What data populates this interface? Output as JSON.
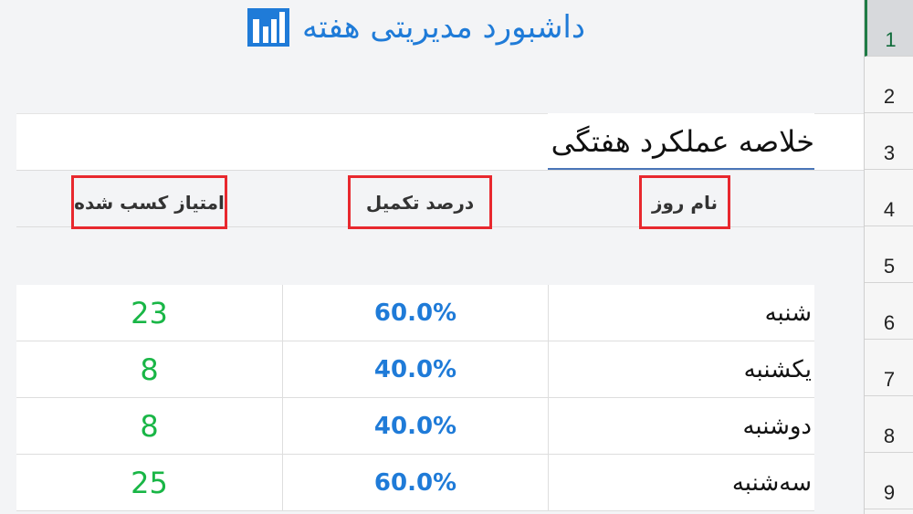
{
  "title": "داشبورد مدیریتی هفته",
  "summary_title": "خلاصه عملکرد هفتگی",
  "headers": {
    "day": "نام روز",
    "completion": "درصد تکمیل",
    "score": "امتیاز کسب شده"
  },
  "rows": [
    {
      "day": "شنبه",
      "completion": "60.0%",
      "score": "23"
    },
    {
      "day": "یکشنبه",
      "completion": "40.0%",
      "score": "8"
    },
    {
      "day": "دوشنبه",
      "completion": "40.0%",
      "score": "8"
    },
    {
      "day": "سه‌شنبه",
      "completion": "60.0%",
      "score": "25"
    }
  ],
  "row_numbers": [
    "1",
    "2",
    "3",
    "4",
    "5",
    "6",
    "7",
    "8",
    "9"
  ],
  "colors": {
    "title": "#1f7bd8",
    "score": "#19b646",
    "completion": "#1f7bd8",
    "highlight_border": "#e8282e"
  },
  "icons": {
    "title_icon": "bar-chart-icon"
  }
}
